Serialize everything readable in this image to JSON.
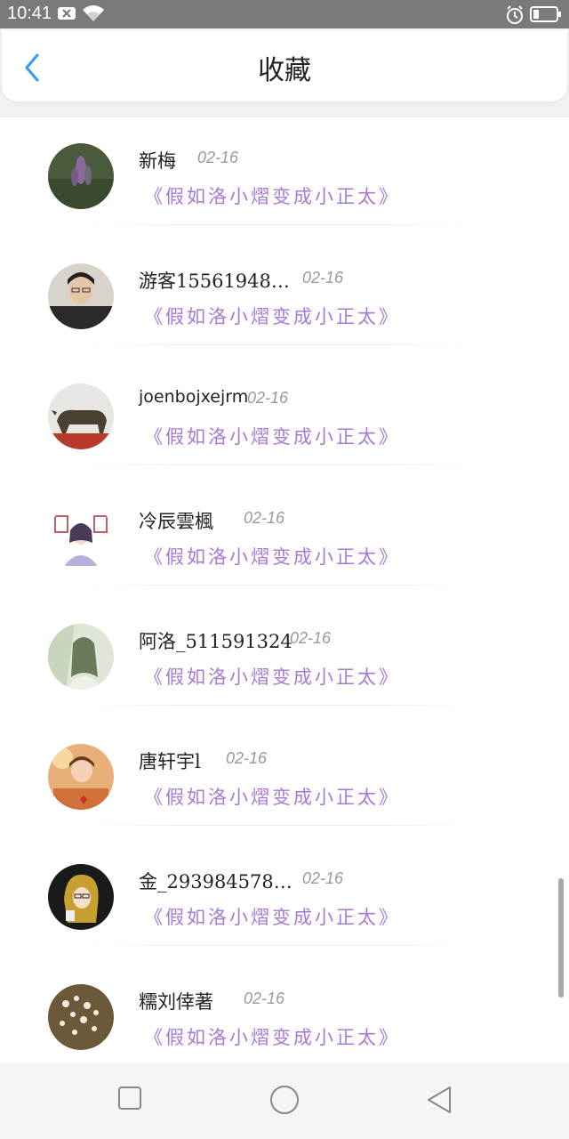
{
  "status_bar": {
    "time": "10:41",
    "icons": [
      "notification-x-icon",
      "wifi-icon",
      "alarm-icon",
      "battery-icon"
    ]
  },
  "header": {
    "title": "收藏",
    "back_icon": "chevron-left-icon",
    "accent": "#3d9be9"
  },
  "list": {
    "items": [
      {
        "user": "新梅",
        "date": "02-16",
        "title": "《假如洛小熠变成小正太》"
      },
      {
        "user": "游客15561948…",
        "date": "02-16",
        "title": "《假如洛小熠变成小正太》"
      },
      {
        "user": "joenbojxejrm",
        "date": "02-16",
        "title": "《假如洛小熠变成小正太》"
      },
      {
        "user": "冷辰雲楓",
        "date": "02-16",
        "title": "《假如洛小熠变成小正太》"
      },
      {
        "user": "阿洛_511591324",
        "date": "02-16",
        "title": "《假如洛小熠变成小正太》"
      },
      {
        "user": "唐轩宇l",
        "date": "02-16",
        "title": "《假如洛小熠变成小正太》"
      },
      {
        "user": "金_293984578…",
        "date": "02-16",
        "title": "《假如洛小熠变成小正太》"
      },
      {
        "user": "糯刘倖著",
        "date": "02-16",
        "title": "《假如洛小熠变成小正太》"
      }
    ]
  },
  "colors": {
    "title_purple": "#a77ad6",
    "date_gray": "#999999",
    "status_bar": "#7a7a7a"
  },
  "nav_bar": {
    "icons": [
      "recent-apps-icon",
      "home-icon",
      "back-triangle-icon"
    ]
  }
}
